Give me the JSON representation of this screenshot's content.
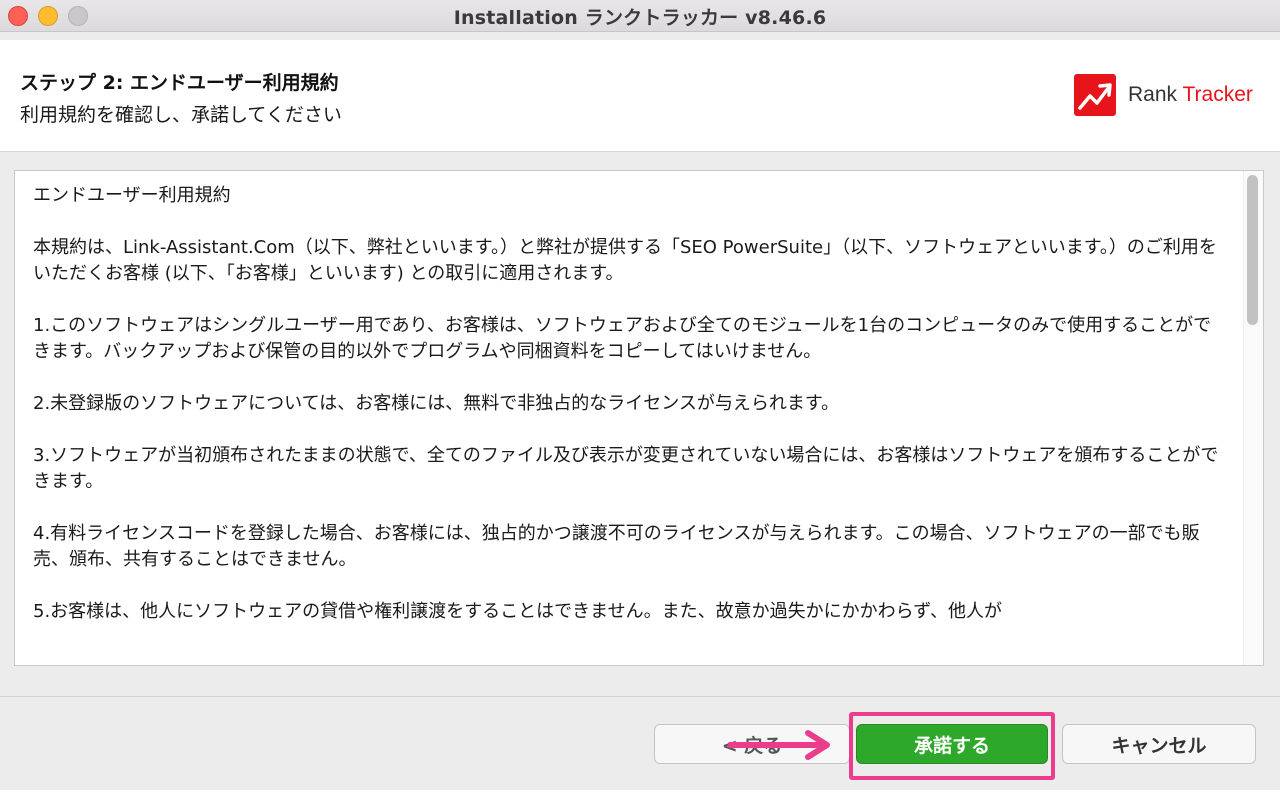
{
  "window": {
    "title": "Installation ランクトラッカー v8.46.6"
  },
  "header": {
    "step_title": "ステップ 2: エンドユーザー利用規約",
    "step_subtitle": "利用規約を確認し、承諾してください",
    "logo_text_main": "Rank ",
    "logo_text_accent": "Tracker"
  },
  "license": {
    "paragraphs": [
      "エンドユーザー利用規約",
      "本規約は、Link-Assistant.Com（以下、弊社といいます。）と弊社が提供する「SEO PowerSuite」（以下、ソフトウェアといいます。）のご利用をいただくお客様 (以下、「お客様」といいます) との取引に適用されます。",
      "1.このソフトウェアはシングルユーザー用であり、お客様は、ソフトウェアおよび全てのモジュールを1台のコンピュータのみで使用することができます。バックアップおよび保管の目的以外でプログラムや同梱資料をコピーしてはいけません。",
      "2.未登録版のソフトウェアについては、お客様には、無料で非独占的なライセンスが与えられます。",
      "3.ソフトウェアが当初頒布されたままの状態で、全てのファイル及び表示が変更されていない場合には、お客様はソフトウェアを頒布することができます。",
      "4.有料ライセンスコードを登録した場合、お客様には、独占的かつ譲渡不可のライセンスが与えられます。この場合、ソフトウェアの一部でも販売、頒布、共有することはできません。",
      "5.お客様は、他人にソフトウェアの貸借や権利譲渡をすることはできません。また、故意か過失かにかかわらず、他人が"
    ]
  },
  "buttons": {
    "back_label": "< 戻る",
    "accept_label": "承諾する",
    "cancel_label": "キャンセル"
  },
  "colors": {
    "accept_green": "#2ea82a",
    "highlight_pink": "#ec3c8c",
    "logo_red": "#e8141b"
  }
}
